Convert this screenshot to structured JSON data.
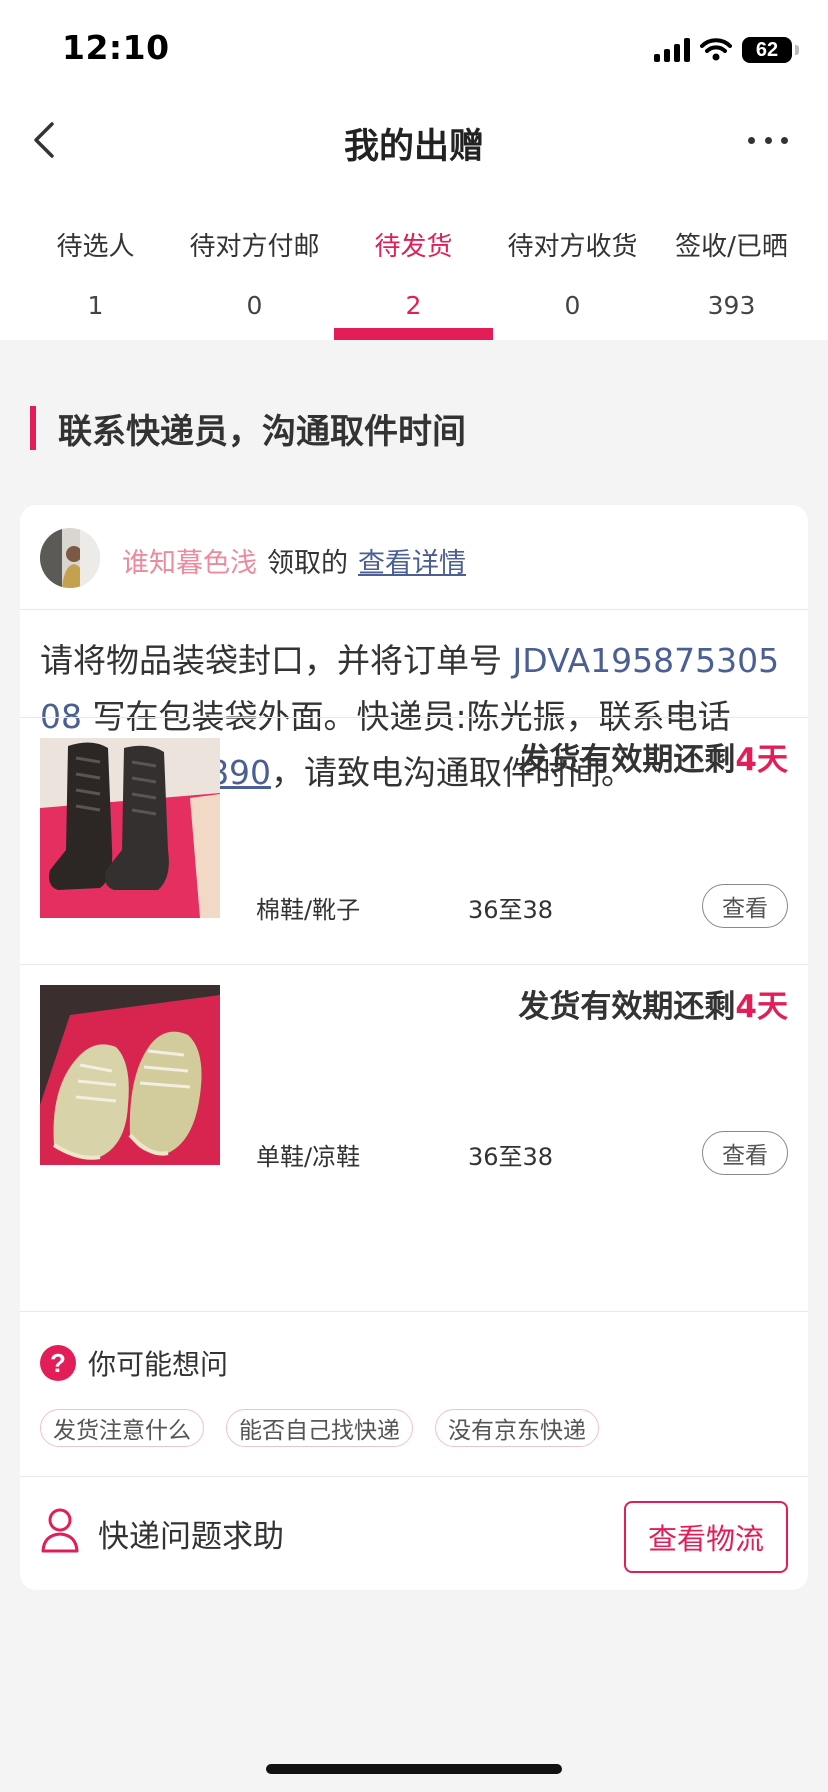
{
  "status_bar": {
    "time": "12:10",
    "battery": "62"
  },
  "nav": {
    "title": "我的出赠",
    "back_icon": "chevron-left-icon",
    "more_icon": "more-dots-icon"
  },
  "tabs": [
    {
      "label": "待选人",
      "count": "1"
    },
    {
      "label": "待对方付邮",
      "count": "0"
    },
    {
      "label": "待发货",
      "count": "2",
      "active": true
    },
    {
      "label": "待对方收货",
      "count": "0"
    },
    {
      "label": "签收/已晒",
      "count": "393"
    }
  ],
  "section": {
    "title": "联系快递员，沟通取件时间"
  },
  "card": {
    "receiver": {
      "nickname": "谁知暮色浅",
      "claimed_text": "领取的",
      "view_detail": "查看详情"
    },
    "instructions": {
      "before_order": "请将物品装袋封口，并将订单号 ",
      "order_no": "JDVA19587530508",
      "after_order": " 写在包装袋外面。快递员:陈光振，联系电话",
      "phone": "18025918890",
      "after_phone": "，请致电沟通取件时间。"
    },
    "items": [
      {
        "deadline_prefix": "发货有效期还剩",
        "deadline_days": "4天",
        "category": "棉鞋/靴子",
        "size": "36至38",
        "view_label": "查看"
      },
      {
        "deadline_prefix": "发货有效期还剩",
        "deadline_days": "4天",
        "category": "单鞋/凉鞋",
        "size": "36至38",
        "view_label": "查看"
      }
    ],
    "faq": {
      "title": "你可能想问",
      "chips": [
        "发货注意什么",
        "能否自己找快递",
        "没有京东快递"
      ]
    },
    "help": {
      "label": "快递问题求助",
      "track_button": "查看物流"
    }
  },
  "colors": {
    "accent": "#e31d57",
    "link": "#4b5f95",
    "nickname": "#ee8a9d",
    "background": "#f4f4f4"
  }
}
